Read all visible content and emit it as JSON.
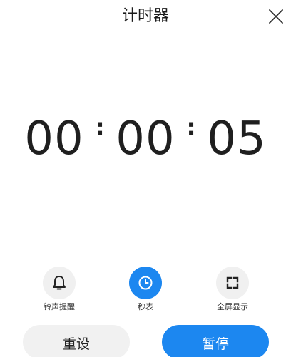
{
  "header": {
    "title": "计时器"
  },
  "timer": {
    "hours": "00",
    "minutes": "00",
    "seconds": "05",
    "separator": ":"
  },
  "tools": [
    {
      "label": "铃声提醒",
      "icon": "bell-icon",
      "active": false
    },
    {
      "label": "秒表",
      "icon": "clock-icon",
      "active": true
    },
    {
      "label": "全屏显示",
      "icon": "fullscreen-icon",
      "active": false
    }
  ],
  "actions": {
    "reset_label": "重设",
    "pause_label": "暂停"
  },
  "colors": {
    "accent": "#1c87f0",
    "button_gray": "#f1f1f1",
    "icon_bg": "#f0f0f0"
  }
}
